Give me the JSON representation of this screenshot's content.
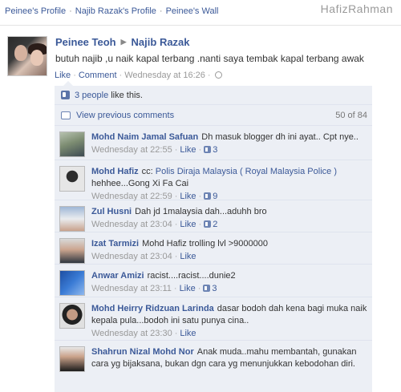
{
  "breadcrumb": {
    "items": [
      "Peinee's Profile",
      "Najib Razak's Profile",
      "Peinee's Wall"
    ],
    "separator": "·"
  },
  "watermark": "HafizRahman",
  "post": {
    "author": "Peinee Teoh",
    "arrow": "▶",
    "target": "Najib Razak",
    "text": "butuh najib ,u naik kapal terbang .nanti saya tembak kapal terbang awak",
    "like_label": "Like",
    "comment_label": "Comment",
    "timestamp": "Wednesday at 16:26",
    "dot": "·"
  },
  "likes": {
    "link": "3 people",
    "rest": "like this."
  },
  "previous": {
    "label": "View previous comments",
    "count": "50 of 84"
  },
  "comments": [
    {
      "name": "Mohd Naim Jamal Safuan",
      "prefix": "",
      "link": "",
      "text": "Dh masuk blogger dh ini ayat.. Cpt nye..",
      "time": "Wednesday at 22:55",
      "like": "Like",
      "count": "3"
    },
    {
      "name": "Mohd Hafiz",
      "prefix": "cc: ",
      "link": "Polis Diraja Malaysia ( Royal Malaysia Police )",
      "text": "hehhee...Gong Xi Fa Cai",
      "time": "Wednesday at 22:59",
      "like": "Like",
      "count": "9"
    },
    {
      "name": "Zul Husni",
      "prefix": "",
      "link": "",
      "text": "Dah jd 1malaysia dah...aduhh bro",
      "time": "Wednesday at 23:04",
      "like": "Like",
      "count": "2"
    },
    {
      "name": "Izat Tarmizi",
      "prefix": "",
      "link": "",
      "text": "Mohd Hafiz trolling lvl >9000000",
      "time": "Wednesday at 23:04",
      "like": "Like",
      "count": ""
    },
    {
      "name": "Anwar Amizi",
      "prefix": "",
      "link": "",
      "text": "racist....racist....dunie2",
      "time": "Wednesday at 23:11",
      "like": "Like",
      "count": "3"
    },
    {
      "name": "Mohd Heirry Ridzuan Larinda",
      "prefix": "",
      "link": "",
      "text": "dasar bodoh dah kena bagi muka naik kepala pula...bodoh ini satu punya cina..",
      "time": "Wednesday at 23:30",
      "like": "Like",
      "count": ""
    },
    {
      "name": "Shahrun Nizal Mohd Nor",
      "prefix": "",
      "link": "",
      "text": "Anak muda..mahu membantah, gunakan cara yg bijaksana, bukan dgn cara yg menunjukkan kebodohan diri.",
      "time": "",
      "like": "",
      "count": ""
    }
  ],
  "colors": {
    "link": "#3b5998",
    "ufi_background": "#eceff5",
    "meta_text": "#999999"
  }
}
